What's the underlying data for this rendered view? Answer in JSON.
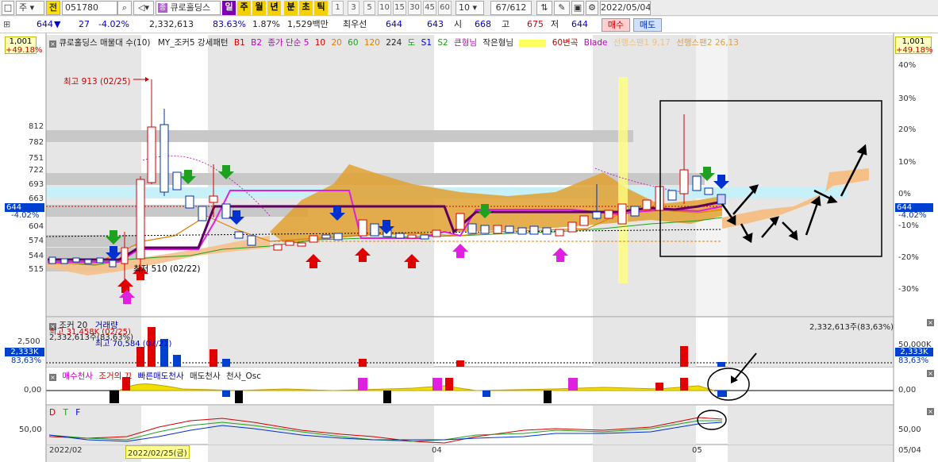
{
  "toolbar": {
    "stock_type": "주",
    "market": "전",
    "code": "051780",
    "stock_name": "큐로홀딩스",
    "periods": [
      "일",
      "주",
      "월",
      "년",
      "분",
      "초",
      "틱"
    ],
    "numbers": [
      "1",
      "3",
      "5",
      "10",
      "15",
      "30",
      "45",
      "60"
    ],
    "interval": "10",
    "page": "67",
    "total": "/612",
    "date": "2022/05/04"
  },
  "infobar": {
    "price": "644",
    "change_arrow": "▼",
    "change": "27",
    "change_pct": "-4.02%",
    "volume": "2,332,613",
    "volume_pct": "83.63%",
    "turnover": "1.87%",
    "amount": "1,529백만",
    "priority_label": "최우선",
    "bid": "644",
    "ask": "643",
    "open_label": "시",
    "open": "668",
    "high_label": "고",
    "high": "675",
    "low_label": "저",
    "low": "644",
    "buy_label": "매수",
    "sell_label": "매도"
  },
  "legend": {
    "title": "큐로홀딩스 매물대 수(10)",
    "items": [
      "MY_조커5 강세패턴",
      "B1",
      "B2",
      "종가 단순 5",
      "10",
      "20",
      "60",
      "120",
      "224",
      "도",
      "S1",
      "S2",
      "큰형님",
      "작은형님",
      "",
      "60변곡",
      "Blade",
      "선행스팬1 9,17",
      "선행스팬2 26,13"
    ],
    "colors": [
      "#000000",
      "#d00000",
      "#c000c0",
      "#c000c0",
      "#d00000",
      "#e08000",
      "#20a020",
      "#e08000",
      "#000000",
      "#20a020",
      "#0000d0",
      "#20a020",
      "#c000c0",
      "#000000",
      "#ffff00",
      "#d00000",
      "#c000c0",
      "#f0c080",
      "#e0a040"
    ]
  },
  "price_axis": {
    "left_top": "1,001",
    "left_top_pct": "+49.18%",
    "right_top": "1,001",
    "right_top_pct": "+49.18%",
    "left_levels": [
      "812",
      "782",
      "751",
      "722",
      "693",
      "663",
      "604",
      "574",
      "544",
      "515"
    ],
    "current": "644",
    "current_pct": "-4.02%",
    "right_pcts": [
      "40%",
      "30%",
      "20%",
      "10%",
      "0%",
      "-10%",
      "-20%",
      "-30%"
    ]
  },
  "annotations": {
    "high": "최고 913 (02/25)",
    "low": "최저 510 (02/22)"
  },
  "volume_panel": {
    "legend": "조커 20",
    "legend2": "거래량",
    "max_note": "최고 31,458K (02/25)",
    "vol_note": "2,332,613주(83,63%)",
    "low_note": "최고 70,584 (02/21)",
    "right_note": "2,332,613주(83,63%)",
    "left_axis": "2,500",
    "left_current": "2,333K",
    "left_pct": "83,63%",
    "right_axis": "50,000K",
    "right_current": "2,333K",
    "right_pct": "83,63%"
  },
  "osc_panel": {
    "items": [
      "매수천사",
      "조거의 끄",
      "빠른매도천사",
      "매도천사",
      "천사_Osc"
    ],
    "colors": [
      "#c000c0",
      "#d00000",
      "#0000d0",
      "#000000",
      "#000000"
    ],
    "left_axis": "0,00",
    "right_axis": "0,00"
  },
  "dtf_panel": {
    "items": [
      "D",
      "T",
      "F"
    ],
    "colors": [
      "#d00000",
      "#20a020",
      "#0000d0"
    ],
    "left_axis": "50,00",
    "right_axis": "50,00"
  },
  "x_axis": {
    "labels": [
      "2022/02",
      "04",
      "05",
      "05/04"
    ],
    "cursor": "2022/02/25(금)"
  }
}
